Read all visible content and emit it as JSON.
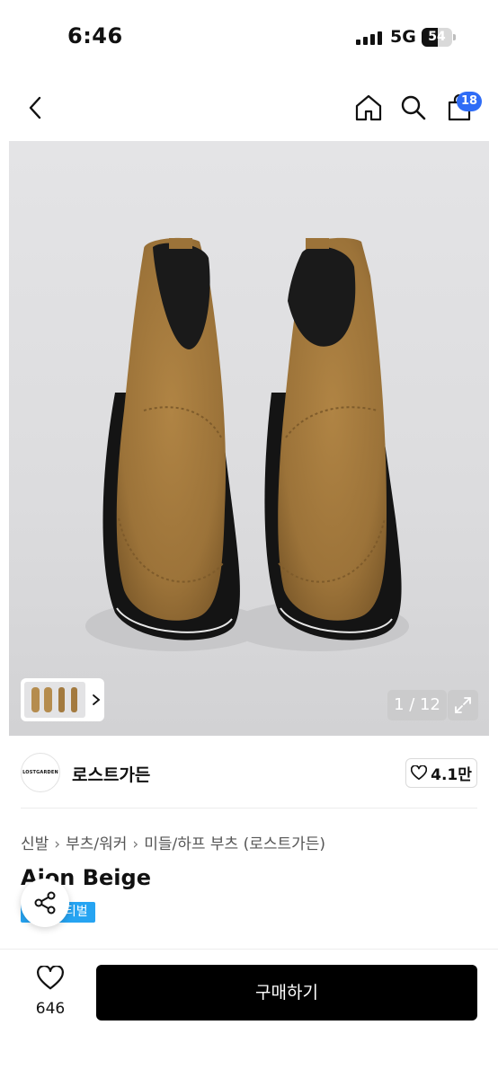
{
  "status_bar": {
    "time": "6:46",
    "network": "5G",
    "battery_level": "54",
    "battery_fraction": 0.54
  },
  "nav": {
    "cart_count": "18"
  },
  "gallery": {
    "counter": "1 / 12"
  },
  "brand": {
    "logo_text": "LOSTGARDEN",
    "name": "로스트가든",
    "likes": "4.1만"
  },
  "breadcrumb": [
    "신발",
    "부츠/워커",
    "미들/하프 부츠 (로스트가든)"
  ],
  "product": {
    "title": "Aion Beige",
    "tag": "스티벌"
  },
  "bottom_bar": {
    "wish_count": "646",
    "buy_label": "구매하기"
  },
  "colors": {
    "accent_blue": "#2f6cf6",
    "tag_blue": "#26a4f2",
    "suede": "#9c7339",
    "button_black": "#000000"
  },
  "icons": [
    "back-icon",
    "home-icon",
    "search-icon",
    "cart-icon",
    "chevron-right-icon",
    "expand-icon",
    "heart-icon",
    "share-icon"
  ]
}
